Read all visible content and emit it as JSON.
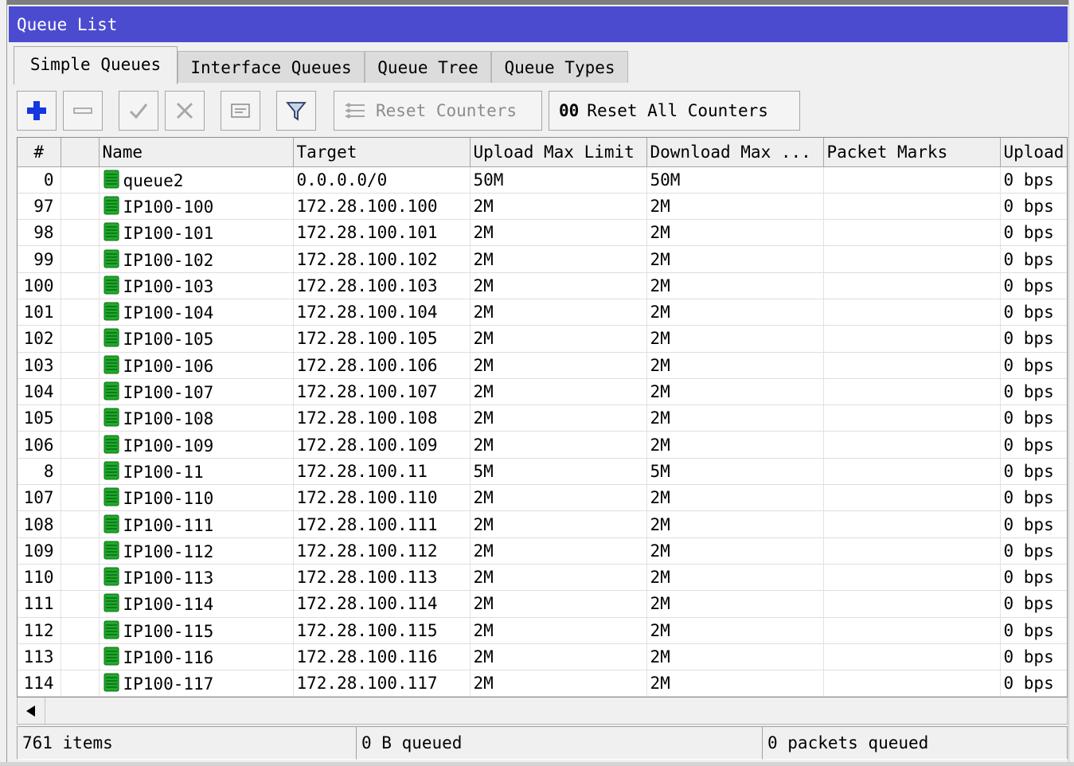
{
  "window": {
    "title": "Queue List"
  },
  "tabs": [
    {
      "label": "Simple Queues",
      "active": true
    },
    {
      "label": "Interface Queues",
      "active": false
    },
    {
      "label": "Queue Tree",
      "active": false
    },
    {
      "label": "Queue Types",
      "active": false
    }
  ],
  "toolbar": {
    "add_icon": "plus-icon",
    "remove_icon": "minus-icon",
    "enable_icon": "check-icon",
    "disable_icon": "cross-icon",
    "comment_icon": "comment-icon",
    "filter_icon": "filter-icon",
    "reset_counters": {
      "icon": "reset-counters-icon",
      "label": "Reset Counters"
    },
    "reset_all_counters": {
      "icon": "00",
      "label": "Reset All Counters"
    }
  },
  "table": {
    "columns": [
      "#",
      "",
      "Name",
      "Target",
      "Upload Max Limit",
      "Download Max ...",
      "Packet Marks",
      "Upload"
    ],
    "rows": [
      {
        "id": "0",
        "name": "queue2",
        "target": "0.0.0.0/0",
        "upload_max": "50M",
        "download_max": "50M",
        "packet_marks": "",
        "upload": "0 bps"
      },
      {
        "id": "97",
        "name": "IP100-100",
        "target": "172.28.100.100",
        "upload_max": "2M",
        "download_max": "2M",
        "packet_marks": "",
        "upload": "0 bps"
      },
      {
        "id": "98",
        "name": "IP100-101",
        "target": "172.28.100.101",
        "upload_max": "2M",
        "download_max": "2M",
        "packet_marks": "",
        "upload": "0 bps"
      },
      {
        "id": "99",
        "name": "IP100-102",
        "target": "172.28.100.102",
        "upload_max": "2M",
        "download_max": "2M",
        "packet_marks": "",
        "upload": "0 bps"
      },
      {
        "id": "100",
        "name": "IP100-103",
        "target": "172.28.100.103",
        "upload_max": "2M",
        "download_max": "2M",
        "packet_marks": "",
        "upload": "0 bps"
      },
      {
        "id": "101",
        "name": "IP100-104",
        "target": "172.28.100.104",
        "upload_max": "2M",
        "download_max": "2M",
        "packet_marks": "",
        "upload": "0 bps"
      },
      {
        "id": "102",
        "name": "IP100-105",
        "target": "172.28.100.105",
        "upload_max": "2M",
        "download_max": "2M",
        "packet_marks": "",
        "upload": "0 bps"
      },
      {
        "id": "103",
        "name": "IP100-106",
        "target": "172.28.100.106",
        "upload_max": "2M",
        "download_max": "2M",
        "packet_marks": "",
        "upload": "0 bps"
      },
      {
        "id": "104",
        "name": "IP100-107",
        "target": "172.28.100.107",
        "upload_max": "2M",
        "download_max": "2M",
        "packet_marks": "",
        "upload": "0 bps"
      },
      {
        "id": "105",
        "name": "IP100-108",
        "target": "172.28.100.108",
        "upload_max": "2M",
        "download_max": "2M",
        "packet_marks": "",
        "upload": "0 bps"
      },
      {
        "id": "106",
        "name": "IP100-109",
        "target": "172.28.100.109",
        "upload_max": "2M",
        "download_max": "2M",
        "packet_marks": "",
        "upload": "0 bps"
      },
      {
        "id": "8",
        "name": "IP100-11",
        "target": "172.28.100.11",
        "upload_max": "5M",
        "download_max": "5M",
        "packet_marks": "",
        "upload": "0 bps"
      },
      {
        "id": "107",
        "name": "IP100-110",
        "target": "172.28.100.110",
        "upload_max": "2M",
        "download_max": "2M",
        "packet_marks": "",
        "upload": "0 bps"
      },
      {
        "id": "108",
        "name": "IP100-111",
        "target": "172.28.100.111",
        "upload_max": "2M",
        "download_max": "2M",
        "packet_marks": "",
        "upload": "0 bps"
      },
      {
        "id": "109",
        "name": "IP100-112",
        "target": "172.28.100.112",
        "upload_max": "2M",
        "download_max": "2M",
        "packet_marks": "",
        "upload": "0 bps"
      },
      {
        "id": "110",
        "name": "IP100-113",
        "target": "172.28.100.113",
        "upload_max": "2M",
        "download_max": "2M",
        "packet_marks": "",
        "upload": "0 bps"
      },
      {
        "id": "111",
        "name": "IP100-114",
        "target": "172.28.100.114",
        "upload_max": "2M",
        "download_max": "2M",
        "packet_marks": "",
        "upload": "0 bps"
      },
      {
        "id": "112",
        "name": "IP100-115",
        "target": "172.28.100.115",
        "upload_max": "2M",
        "download_max": "2M",
        "packet_marks": "",
        "upload": "0 bps"
      },
      {
        "id": "113",
        "name": "IP100-116",
        "target": "172.28.100.116",
        "upload_max": "2M",
        "download_max": "2M",
        "packet_marks": "",
        "upload": "0 bps"
      },
      {
        "id": "114",
        "name": "IP100-117",
        "target": "172.28.100.117",
        "upload_max": "2M",
        "download_max": "2M",
        "packet_marks": "",
        "upload": "0 bps"
      }
    ]
  },
  "scroll": {
    "left_icon": "arrow-left-icon"
  },
  "status": {
    "items": "761 items",
    "queued_bytes": "0 B queued",
    "queued_packets": "0 packets queued"
  },
  "colors": {
    "titlebar": "#4b4bd0",
    "queue_icon": "#1faa2b",
    "add_icon": "#1536e0"
  }
}
